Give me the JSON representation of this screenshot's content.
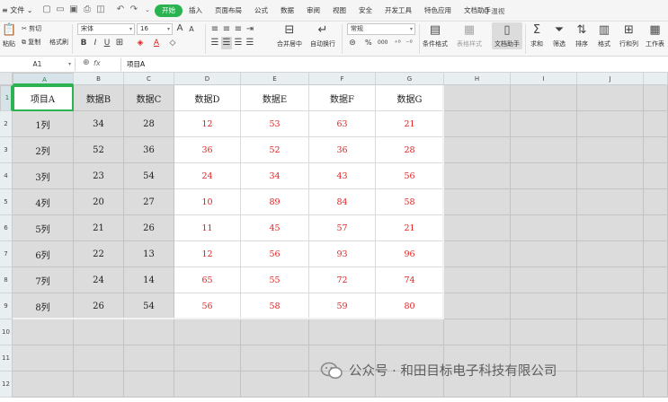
{
  "menubar": {
    "file_label": "≡ 文件 ⌄",
    "tabs": [
      "开始",
      "插入",
      "页面布局",
      "公式",
      "数据",
      "审阅",
      "视图",
      "安全",
      "开发工具",
      "特色应用",
      "文档助手"
    ],
    "active_tab": "开始",
    "search_label": "Q 温视"
  },
  "ribbon": {
    "paste": "粘贴",
    "cut": "剪切",
    "copy": "复制",
    "format_painter": "格式刷",
    "font_name": "宋体",
    "font_size": "16",
    "merge_center": "合并居中",
    "wrap_text": "自动换行",
    "number_format": "常规",
    "percent_symbol": "%",
    "thousands_symbol": "000",
    "conditional_format": "条件格式",
    "table_style": "表格样式",
    "doc_helper": "文档助手",
    "sum": "求和",
    "filter": "筛选",
    "sort": "排序",
    "format": "格式",
    "row_col": "行和列",
    "worksheet": "工作表"
  },
  "formula_bar": {
    "name_box": "A1",
    "fx_label": "fx",
    "content": "项目A"
  },
  "sheet": {
    "columns": [
      "A",
      "B",
      "C",
      "D",
      "E",
      "F",
      "G",
      "H",
      "I",
      "J"
    ],
    "rows": [
      "1",
      "2",
      "3",
      "4",
      "5",
      "6",
      "7",
      "8",
      "9",
      "10",
      "11",
      "12"
    ],
    "header_row": [
      "项目A",
      "数据B",
      "数据C",
      "数据D",
      "数据E",
      "数据F",
      "数据G"
    ],
    "data": [
      [
        "1列",
        "34",
        "28",
        "12",
        "53",
        "63",
        "21"
      ],
      [
        "2列",
        "52",
        "36",
        "36",
        "52",
        "36",
        "28"
      ],
      [
        "3列",
        "23",
        "54",
        "24",
        "34",
        "43",
        "56"
      ],
      [
        "4列",
        "20",
        "27",
        "10",
        "89",
        "84",
        "58"
      ],
      [
        "5列",
        "21",
        "26",
        "11",
        "45",
        "57",
        "21"
      ],
      [
        "6列",
        "22",
        "13",
        "12",
        "56",
        "93",
        "96"
      ],
      [
        "7列",
        "24",
        "14",
        "65",
        "55",
        "72",
        "74"
      ],
      [
        "8列",
        "26",
        "54",
        "56",
        "58",
        "59",
        "80"
      ]
    ]
  },
  "watermark": {
    "text": "公众号 · 和田目标电子科技有限公司"
  },
  "colors": {
    "accent_green": "#2bb352",
    "data_red": "#e02020",
    "gray_fill": "#dcdcdc"
  }
}
